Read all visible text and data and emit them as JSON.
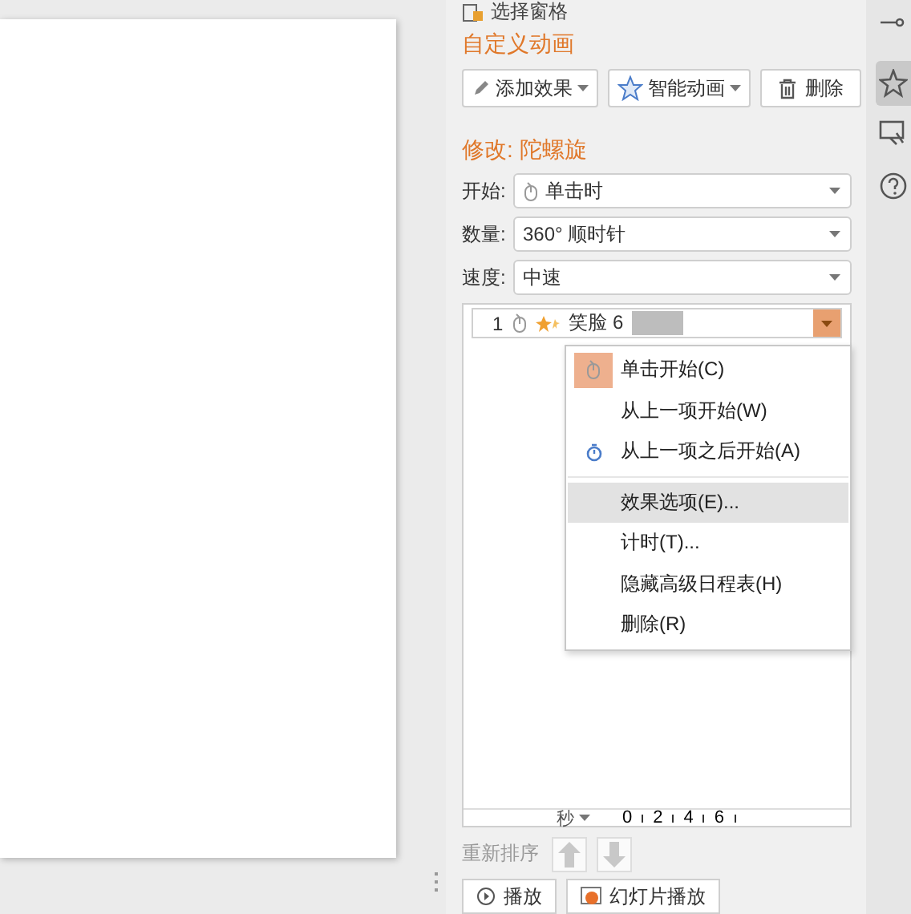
{
  "pane_header": {
    "title": "选择窗格"
  },
  "section_title": "自定义动画",
  "toolbar": [
    {
      "label": "添加效果",
      "kind": "dropdown"
    },
    {
      "label": "智能动画",
      "kind": "dropdown"
    },
    {
      "label": "删除",
      "kind": "button"
    }
  ],
  "modify_title": "修改: 陀螺旋",
  "fields": [
    {
      "label": "开始:",
      "value": "单击时"
    },
    {
      "label": "数量:",
      "value": "360° 顺时针"
    },
    {
      "label": "速度:",
      "value": "中速"
    }
  ],
  "animation_list": [
    {
      "number": "1",
      "name": "笑脸 6",
      "selected": true
    }
  ],
  "context_menu": {
    "groups": [
      [
        {
          "label": "单击开始(C)",
          "checked": true,
          "highlighted": false
        },
        {
          "label": "从上一项开始(W)",
          "checked": false,
          "highlighted": false
        },
        {
          "label": "从上一项之后开始(A)",
          "checked": false,
          "highlighted": false
        }
      ],
      [
        {
          "label": "效果选项(E)...",
          "highlighted": true
        },
        {
          "label": "计时(T)...",
          "highlighted": false
        },
        {
          "label": "隐藏高级日程表(H)",
          "highlighted": false
        },
        {
          "label": "删除(R)",
          "highlighted": false
        }
      ]
    ]
  },
  "timeline": {
    "unit": "秒",
    "ticks": [
      "0",
      "2",
      "4",
      "6"
    ]
  },
  "reorder": {
    "label": "重新排序"
  },
  "bottom_buttons": [
    "播放",
    "幻灯片播放"
  ],
  "side_tabs": [
    {
      "selected": false
    },
    {
      "selected": true
    },
    {
      "selected": false
    },
    {
      "selected": false
    }
  ]
}
